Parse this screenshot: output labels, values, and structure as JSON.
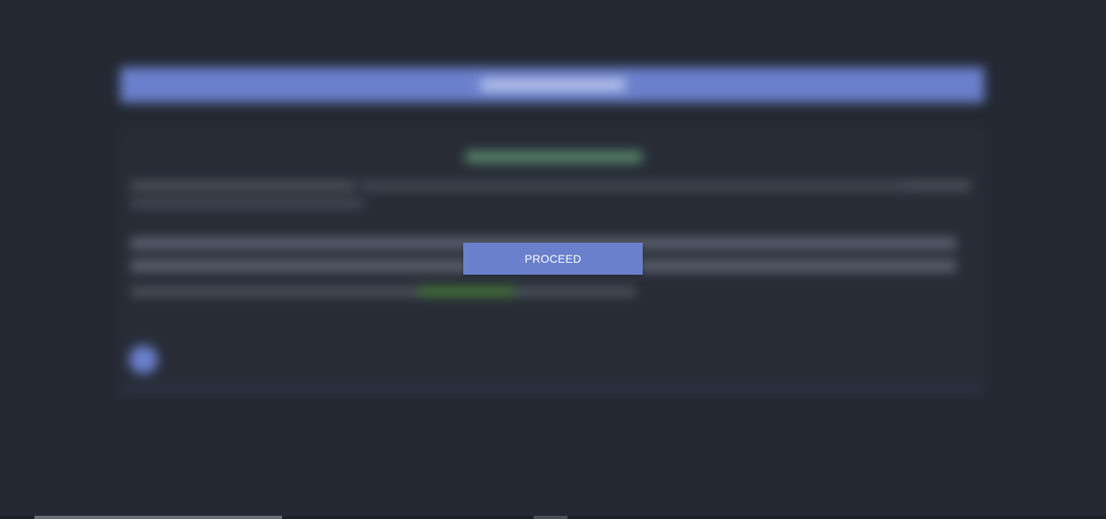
{
  "overlay": {
    "proceed_label": "PROCEED"
  },
  "colors": {
    "background": "#242933",
    "accent": "#6a80cc",
    "button_text": "#ffffff"
  }
}
